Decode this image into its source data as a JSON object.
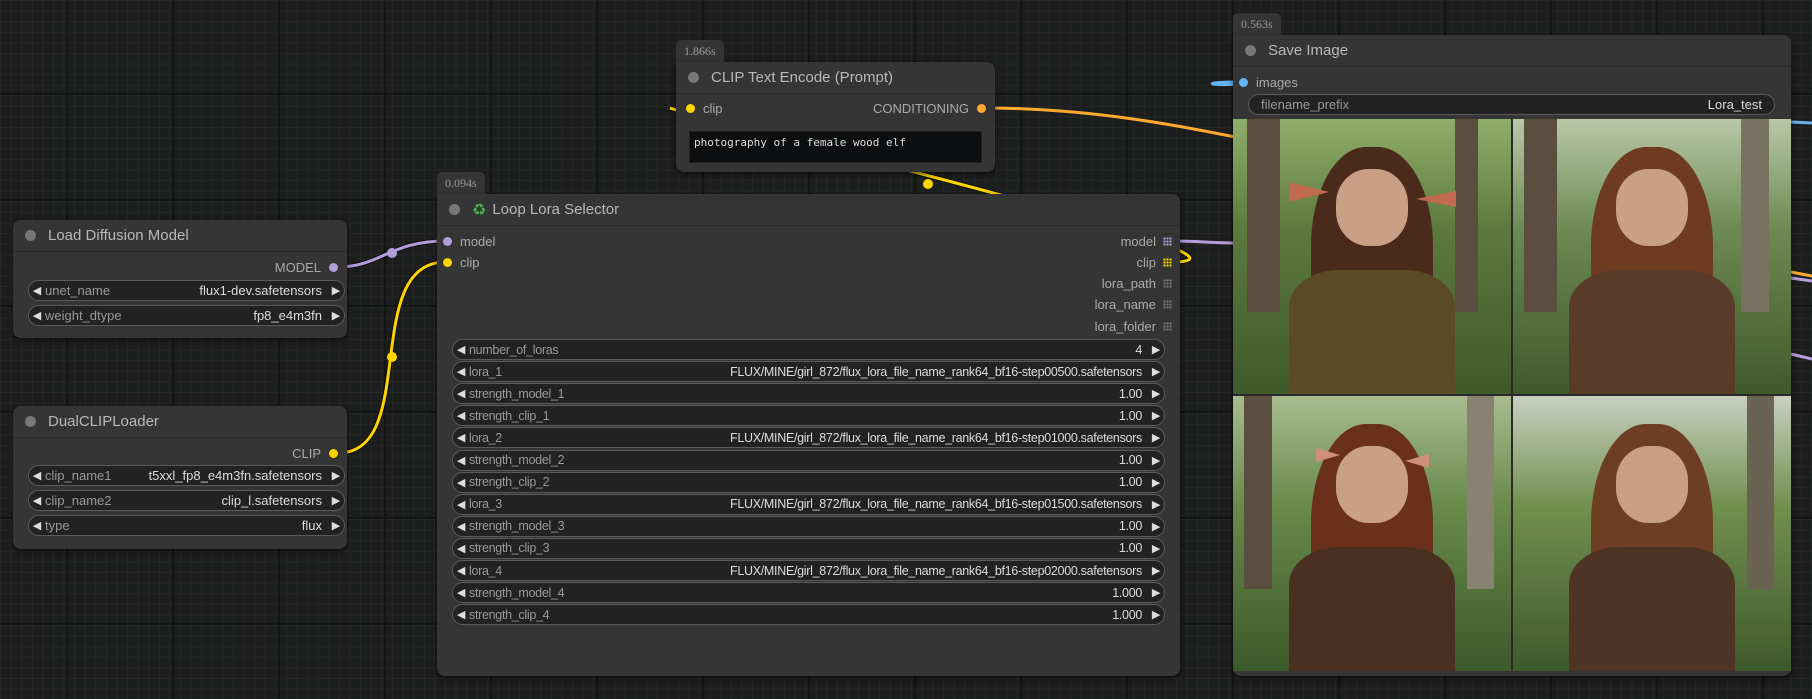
{
  "canvas": {
    "link_colors": {
      "model": "#b39ddb",
      "clip": "#ffd500",
      "conditioning": "#ffa931",
      "image": "#64b5f6"
    }
  },
  "nodes": {
    "load_diffusion_model": {
      "title": "Load Diffusion Model",
      "outputs": [
        {
          "label": "MODEL",
          "type": "model"
        }
      ],
      "widgets": [
        {
          "label": "unet_name",
          "value": "flux1-dev.safetensors"
        },
        {
          "label": "weight_dtype",
          "value": "fp8_e4m3fn"
        }
      ]
    },
    "dual_clip_loader": {
      "title": "DualCLIPLoader",
      "outputs": [
        {
          "label": "CLIP",
          "type": "clip"
        }
      ],
      "widgets": [
        {
          "label": "clip_name1",
          "value": "t5xxl_fp8_e4m3fn.safetensors"
        },
        {
          "label": "clip_name2",
          "value": "clip_l.safetensors"
        },
        {
          "label": "type",
          "value": "flux"
        }
      ]
    },
    "clip_text_encode": {
      "badge": "1.866s",
      "title": "CLIP Text Encode (Prompt)",
      "inputs": [
        {
          "label": "clip",
          "type": "clip"
        }
      ],
      "outputs": [
        {
          "label": "CONDITIONING",
          "type": "conditioning"
        }
      ],
      "text": "photography of a female wood elf"
    },
    "loop_lora_selector": {
      "badge": "0.094s",
      "icon": "recycle-icon",
      "title": "Loop Lora Selector",
      "inputs": [
        {
          "label": "model",
          "type": "model"
        },
        {
          "label": "clip",
          "type": "clip"
        }
      ],
      "outputs": [
        {
          "label": "model",
          "type": "model"
        },
        {
          "label": "clip",
          "type": "clip"
        },
        {
          "label": "lora_path",
          "type": "other"
        },
        {
          "label": "lora_name",
          "type": "other"
        },
        {
          "label": "lora_folder",
          "type": "other"
        }
      ],
      "widgets": [
        {
          "label": "number_of_loras",
          "value": "4"
        },
        {
          "label": "lora_1",
          "value": "FLUX/MINE/girl_872/flux_lora_file_name_rank64_bf16-step00500.safetensors"
        },
        {
          "label": "strength_model_1",
          "value": "1.00"
        },
        {
          "label": "strength_clip_1",
          "value": "1.00"
        },
        {
          "label": "lora_2",
          "value": "FLUX/MINE/girl_872/flux_lora_file_name_rank64_bf16-step01000.safetensors"
        },
        {
          "label": "strength_model_2",
          "value": "1.00"
        },
        {
          "label": "strength_clip_2",
          "value": "1.00"
        },
        {
          "label": "lora_3",
          "value": "FLUX/MINE/girl_872/flux_lora_file_name_rank64_bf16-step01500.safetensors"
        },
        {
          "label": "strength_model_3",
          "value": "1.00"
        },
        {
          "label": "strength_clip_3",
          "value": "1.00"
        },
        {
          "label": "lora_4",
          "value": "FLUX/MINE/girl_872/flux_lora_file_name_rank64_bf16-step02000.safetensors"
        },
        {
          "label": "strength_model_4",
          "value": "1.000"
        },
        {
          "label": "strength_clip_4",
          "value": "1.000"
        }
      ]
    },
    "save_image": {
      "badge": "0.563s",
      "title": "Save Image",
      "inputs": [
        {
          "label": "images",
          "type": "image"
        }
      ],
      "widgets": [
        {
          "label": "filename_prefix",
          "value": "Lora_test"
        }
      ],
      "preview_images": [
        {
          "alt": "wood elf portrait 1 - olive sweater, large elf ears"
        },
        {
          "alt": "wood elf portrait 2 - brown laced top"
        },
        {
          "alt": "wood elf portrait 3 - brown off-shoulder top, elf ears"
        },
        {
          "alt": "wood elf portrait 4 - brown off-shoulder top"
        }
      ]
    }
  }
}
